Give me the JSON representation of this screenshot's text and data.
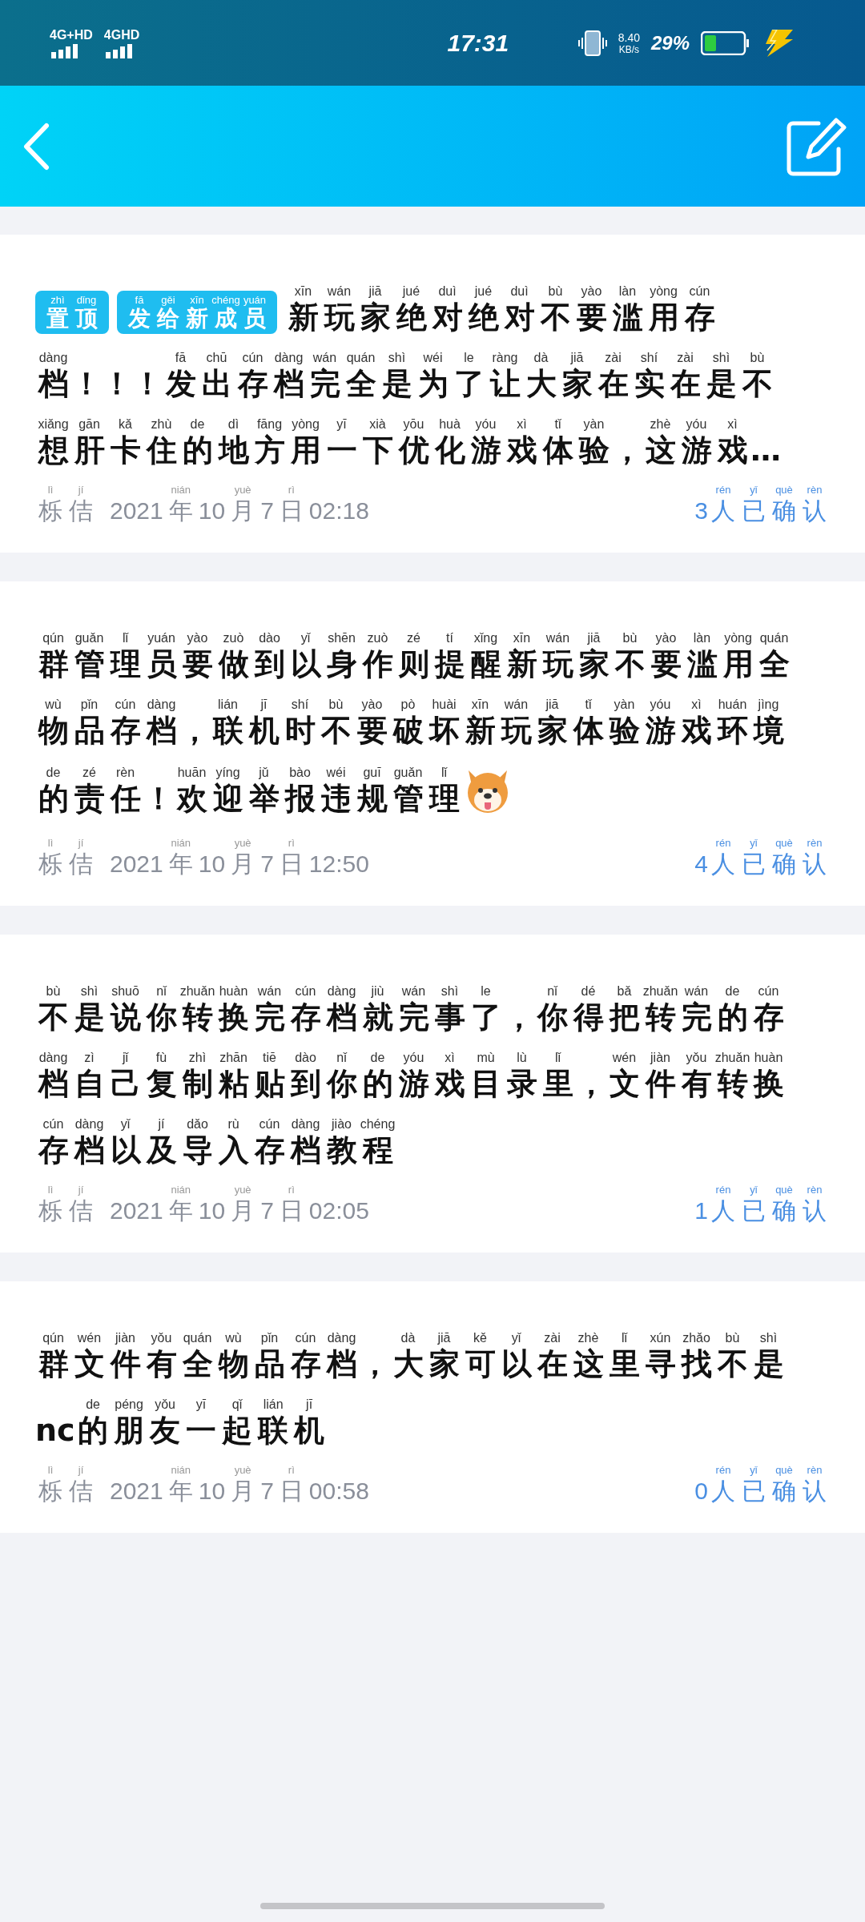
{
  "status_bar": {
    "network_1": "4G+HD",
    "network_2": "4GHD",
    "time": "17:31",
    "speed_value": "8.40",
    "speed_unit": "KB/s",
    "battery": "29%"
  },
  "notices": [
    {
      "tags": [
        [
          [
            "zhì",
            "置"
          ],
          [
            "dǐng",
            "顶"
          ]
        ],
        [
          [
            "fā",
            "发"
          ],
          [
            "gěi",
            "给"
          ],
          [
            "xīn",
            "新"
          ],
          [
            "chéng",
            "成"
          ],
          [
            "yuán",
            "员"
          ]
        ]
      ],
      "lines": [
        [
          [
            "xīn",
            "新"
          ],
          [
            "wán",
            "玩"
          ],
          [
            "jiā",
            "家"
          ],
          [
            "jué",
            "绝"
          ],
          [
            "duì",
            "对"
          ],
          [
            "jué",
            "绝"
          ],
          [
            "duì",
            "对"
          ],
          [
            "bù",
            "不"
          ],
          [
            "yào",
            "要"
          ],
          [
            "làn",
            "滥"
          ],
          [
            "yòng",
            "用"
          ],
          [
            "cún",
            "存"
          ]
        ],
        [
          [
            "dàng",
            "档"
          ],
          [
            "！"
          ],
          [
            "！"
          ],
          [
            "！"
          ],
          [
            "fā",
            "发"
          ],
          [
            "chū",
            "出"
          ],
          [
            "cún",
            "存"
          ],
          [
            "dàng",
            "档"
          ],
          [
            "wán",
            "完"
          ],
          [
            "quán",
            "全"
          ],
          [
            "shì",
            "是"
          ],
          [
            "wéi",
            "为"
          ],
          [
            "le",
            "了"
          ],
          [
            "ràng",
            "让"
          ],
          [
            "dà",
            "大"
          ],
          [
            "jiā",
            "家"
          ],
          [
            "zài",
            "在"
          ],
          [
            "shí",
            "实"
          ],
          [
            "zài",
            "在"
          ],
          [
            "shì",
            "是"
          ],
          [
            "bù",
            "不"
          ]
        ],
        [
          [
            "xiǎng",
            "想"
          ],
          [
            "gān",
            "肝"
          ],
          [
            "kǎ",
            "卡"
          ],
          [
            "zhù",
            "住"
          ],
          [
            "de",
            "的"
          ],
          [
            "dì",
            "地"
          ],
          [
            "fāng",
            "方"
          ],
          [
            "yòng",
            "用"
          ],
          [
            "yī",
            "一"
          ],
          [
            "xià",
            "下"
          ],
          [
            "yōu",
            "优"
          ],
          [
            "huà",
            "化"
          ],
          [
            "yóu",
            "游"
          ],
          [
            "xì",
            "戏"
          ],
          [
            "tǐ",
            "体"
          ],
          [
            "yàn",
            "验"
          ],
          [
            "，"
          ],
          [
            "zhè",
            "这"
          ],
          [
            "yóu",
            "游"
          ],
          [
            "xì",
            "戏"
          ],
          [
            "…"
          ]
        ]
      ],
      "has_icon": false,
      "author": [
        [
          "lì",
          "栎"
        ],
        [
          "jí",
          "佶"
        ]
      ],
      "date": [
        [
          "2021"
        ],
        [
          "nián",
          "年"
        ],
        [
          "10"
        ],
        [
          "yuè",
          "月"
        ],
        [
          "7"
        ],
        [
          "rì",
          "日"
        ],
        [
          "02:18"
        ]
      ],
      "confirmed": [
        [
          "3"
        ],
        [
          "rén",
          "人"
        ],
        [
          "yǐ",
          "已"
        ],
        [
          "què",
          "确"
        ],
        [
          "rèn",
          "认"
        ]
      ]
    },
    {
      "lines": [
        [
          [
            "qún",
            "群"
          ],
          [
            "guǎn",
            "管"
          ],
          [
            "lǐ",
            "理"
          ],
          [
            "yuán",
            "员"
          ],
          [
            "yào",
            "要"
          ],
          [
            "zuò",
            "做"
          ],
          [
            "dào",
            "到"
          ],
          [
            "yǐ",
            "以"
          ],
          [
            "shēn",
            "身"
          ],
          [
            "zuò",
            "作"
          ],
          [
            "zé",
            "则"
          ],
          [
            "tí",
            "提"
          ],
          [
            "xǐng",
            "醒"
          ],
          [
            "xīn",
            "新"
          ],
          [
            "wán",
            "玩"
          ],
          [
            "jiā",
            "家"
          ],
          [
            "bù",
            "不"
          ],
          [
            "yào",
            "要"
          ],
          [
            "làn",
            "滥"
          ],
          [
            "yòng",
            "用"
          ],
          [
            "quán",
            "全"
          ]
        ],
        [
          [
            "wù",
            "物"
          ],
          [
            "pǐn",
            "品"
          ],
          [
            "cún",
            "存"
          ],
          [
            "dàng",
            "档"
          ],
          [
            "，"
          ],
          [
            "lián",
            "联"
          ],
          [
            "jī",
            "机"
          ],
          [
            "shí",
            "时"
          ],
          [
            "bù",
            "不"
          ],
          [
            "yào",
            "要"
          ],
          [
            "pò",
            "破"
          ],
          [
            "huài",
            "坏"
          ],
          [
            "xīn",
            "新"
          ],
          [
            "wán",
            "玩"
          ],
          [
            "jiā",
            "家"
          ],
          [
            "tǐ",
            "体"
          ],
          [
            "yàn",
            "验"
          ],
          [
            "yóu",
            "游"
          ],
          [
            "xì",
            "戏"
          ],
          [
            "huán",
            "环"
          ],
          [
            "jìng",
            "境"
          ]
        ],
        [
          [
            "de",
            "的"
          ],
          [
            "zé",
            "责"
          ],
          [
            "rèn",
            "任"
          ],
          [
            "！"
          ],
          [
            "huān",
            "欢"
          ],
          [
            "yíng",
            "迎"
          ],
          [
            "jǔ",
            "举"
          ],
          [
            "bào",
            "报"
          ],
          [
            "wéi",
            "违"
          ],
          [
            "guī",
            "规"
          ],
          [
            "guǎn",
            "管"
          ],
          [
            "lǐ",
            "理"
          ]
        ]
      ],
      "has_icon": true,
      "author": [
        [
          "lì",
          "栎"
        ],
        [
          "jí",
          "佶"
        ]
      ],
      "date": [
        [
          "2021"
        ],
        [
          "nián",
          "年"
        ],
        [
          "10"
        ],
        [
          "yuè",
          "月"
        ],
        [
          "7"
        ],
        [
          "rì",
          "日"
        ],
        [
          "12:50"
        ]
      ],
      "confirmed": [
        [
          "4"
        ],
        [
          "rén",
          "人"
        ],
        [
          "yǐ",
          "已"
        ],
        [
          "què",
          "确"
        ],
        [
          "rèn",
          "认"
        ]
      ]
    },
    {
      "lines": [
        [
          [
            "bù",
            "不"
          ],
          [
            "shì",
            "是"
          ],
          [
            "shuō",
            "说"
          ],
          [
            "nǐ",
            "你"
          ],
          [
            "zhuǎn",
            "转"
          ],
          [
            "huàn",
            "换"
          ],
          [
            "wán",
            "完"
          ],
          [
            "cún",
            "存"
          ],
          [
            "dàng",
            "档"
          ],
          [
            "jiù",
            "就"
          ],
          [
            "wán",
            "完"
          ],
          [
            "shì",
            "事"
          ],
          [
            "le",
            "了"
          ],
          [
            "，"
          ],
          [
            "nǐ",
            "你"
          ],
          [
            "dé",
            "得"
          ],
          [
            "bǎ",
            "把"
          ],
          [
            "zhuǎn",
            "转"
          ],
          [
            "wán",
            "完"
          ],
          [
            "de",
            "的"
          ],
          [
            "cún",
            "存"
          ]
        ],
        [
          [
            "dàng",
            "档"
          ],
          [
            "zì",
            "自"
          ],
          [
            "jǐ",
            "己"
          ],
          [
            "fù",
            "复"
          ],
          [
            "zhì",
            "制"
          ],
          [
            "zhān",
            "粘"
          ],
          [
            "tiē",
            "贴"
          ],
          [
            "dào",
            "到"
          ],
          [
            "nǐ",
            "你"
          ],
          [
            "de",
            "的"
          ],
          [
            "yóu",
            "游"
          ],
          [
            "xì",
            "戏"
          ],
          [
            "mù",
            "目"
          ],
          [
            "lù",
            "录"
          ],
          [
            "lǐ",
            "里"
          ],
          [
            "，"
          ],
          [
            "wén",
            "文"
          ],
          [
            "jiàn",
            "件"
          ],
          [
            "yǒu",
            "有"
          ],
          [
            "zhuǎn",
            "转"
          ],
          [
            "huàn",
            "换"
          ]
        ],
        [
          [
            "cún",
            "存"
          ],
          [
            "dàng",
            "档"
          ],
          [
            "yǐ",
            "以"
          ],
          [
            "jí",
            "及"
          ],
          [
            "dǎo",
            "导"
          ],
          [
            "rù",
            "入"
          ],
          [
            "cún",
            "存"
          ],
          [
            "dàng",
            "档"
          ],
          [
            "jiào",
            "教"
          ],
          [
            "chéng",
            "程"
          ]
        ]
      ],
      "has_icon": false,
      "author": [
        [
          "lì",
          "栎"
        ],
        [
          "jí",
          "佶"
        ]
      ],
      "date": [
        [
          "2021"
        ],
        [
          "nián",
          "年"
        ],
        [
          "10"
        ],
        [
          "yuè",
          "月"
        ],
        [
          "7"
        ],
        [
          "rì",
          "日"
        ],
        [
          "02:05"
        ]
      ],
      "confirmed": [
        [
          "1"
        ],
        [
          "rén",
          "人"
        ],
        [
          "yǐ",
          "已"
        ],
        [
          "què",
          "确"
        ],
        [
          "rèn",
          "认"
        ]
      ]
    },
    {
      "lines": [
        [
          [
            "qún",
            "群"
          ],
          [
            "wén",
            "文"
          ],
          [
            "jiàn",
            "件"
          ],
          [
            "yǒu",
            "有"
          ],
          [
            "quán",
            "全"
          ],
          [
            "wù",
            "物"
          ],
          [
            "pǐn",
            "品"
          ],
          [
            "cún",
            "存"
          ],
          [
            "dàng",
            "档"
          ],
          [
            "，"
          ],
          [
            "dà",
            "大"
          ],
          [
            "jiā",
            "家"
          ],
          [
            "kě",
            "可"
          ],
          [
            "yǐ",
            "以"
          ],
          [
            "zài",
            "在"
          ],
          [
            "zhè",
            "这"
          ],
          [
            "lǐ",
            "里"
          ],
          [
            "xún",
            "寻"
          ],
          [
            "zhǎo",
            "找"
          ],
          [
            "bù",
            "不"
          ],
          [
            "shì",
            "是"
          ]
        ],
        [
          [
            "nc"
          ],
          [
            "de",
            "的"
          ],
          [
            "péng",
            "朋"
          ],
          [
            "yǒu",
            "友"
          ],
          [
            "yī",
            "一"
          ],
          [
            "qǐ",
            "起"
          ],
          [
            "lián",
            "联"
          ],
          [
            "jī",
            "机"
          ]
        ]
      ],
      "has_icon": false,
      "author": [
        [
          "lì",
          "栎"
        ],
        [
          "jí",
          "佶"
        ]
      ],
      "date": [
        [
          "2021"
        ],
        [
          "nián",
          "年"
        ],
        [
          "10"
        ],
        [
          "yuè",
          "月"
        ],
        [
          "7"
        ],
        [
          "rì",
          "日"
        ],
        [
          "00:58"
        ]
      ],
      "confirmed": [
        [
          "0"
        ],
        [
          "rén",
          "人"
        ],
        [
          "yǐ",
          "已"
        ],
        [
          "què",
          "确"
        ],
        [
          "rèn",
          "认"
        ]
      ]
    }
  ]
}
